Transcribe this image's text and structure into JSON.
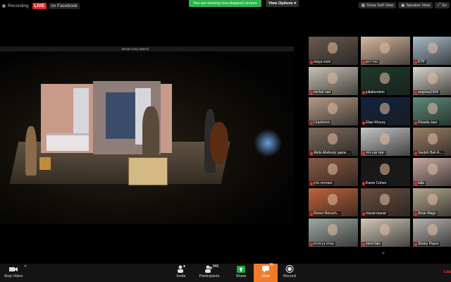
{
  "top": {
    "recording": "Recording",
    "live": "LIVE",
    "live_dest": "on Facebook",
    "banner": "You are viewing noa.shapira's screen",
    "view_options": "View Options",
    "self_view": "Show Self View",
    "speaker_view": "Speaker View",
    "exit": "Ex"
  },
  "share": {
    "title": "Dimitri Ioniy Manzil"
  },
  "gallery": [
    {
      "name": "maya rozin",
      "bg": "#6b5a4f"
    },
    {
      "name": "הדר רוזן",
      "bg": "#d7b9a2"
    },
    {
      "name": "ETP",
      "bg": "#a8bcc9"
    },
    {
      "name": "michal nad",
      "bg": "#c9c2b5"
    },
    {
      "name": "juliaburstein",
      "bg": "#1c3b2a"
    },
    {
      "name": "angelaq1934",
      "bg": "#d9d4cc"
    },
    {
      "name": "Lirazkoren",
      "bg": "#b39a85"
    },
    {
      "name": "Elias Khoury",
      "bg": "#12243f"
    },
    {
      "name": "Khawla nasr",
      "bg": "#5f8c7a"
    },
    {
      "name": "Abdo Abdoody game ...",
      "bg": "#7f6b5c"
    },
    {
      "name": "יוסף אבו חיזי",
      "bg": "#c5c5c5"
    },
    {
      "name": "Vardeh Beh A...",
      "bg": "#9d8067"
    },
    {
      "name": "משפחת אלון",
      "bg": "#8a5a44"
    },
    {
      "name": "Karen Cohen",
      "bg": "#181818"
    },
    {
      "name": "lalla",
      "bg": "#c8a9a0"
    },
    {
      "name": "Ronen Bensch...",
      "bg": "#c0643c"
    },
    {
      "name": "manal manal",
      "bg": "#6a4f3f"
    },
    {
      "name": "Amar Alago",
      "bg": "#b6a88f"
    },
    {
      "name": "עמית בן חרות",
      "bg": "#9fa9a4"
    },
    {
      "name": "mirel ilain",
      "bg": "#d2c7b8"
    },
    {
      "name": "Shany Payes",
      "bg": "#b7b2ad"
    }
  ],
  "toolbar": {
    "stop_video": "Stop Video",
    "invite": "Invite",
    "participants": "Participants",
    "participants_count": "846",
    "share": "Share",
    "chat": "Chat",
    "chat_count": "78",
    "record": "Record",
    "leave": "Lea"
  },
  "colors": {
    "banner": "#2fb24a",
    "live": "#e02a2a",
    "share_icon": "#22aa44",
    "chat_active": "#ef7a28"
  }
}
